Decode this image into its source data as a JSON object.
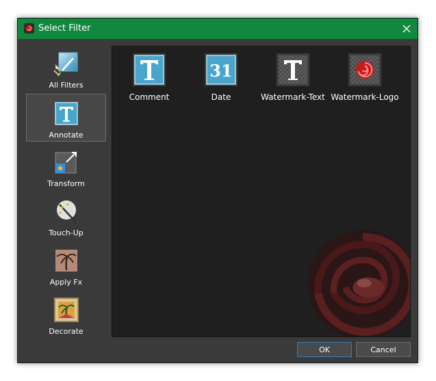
{
  "window": {
    "title": "Select Filter",
    "accent": "#10893e"
  },
  "categories": [
    {
      "label": "All Filters",
      "icon": "magic-wand-icon"
    },
    {
      "label": "Annotate",
      "icon": "text-t-icon"
    },
    {
      "label": "Transform",
      "icon": "resize-arrow-icon"
    },
    {
      "label": "Touch-Up",
      "icon": "wand-sparkle-icon"
    },
    {
      "label": "Apply Fx",
      "icon": "palm-tree-icon"
    },
    {
      "label": "Decorate",
      "icon": "framed-palm-icon"
    }
  ],
  "selected_category": "Annotate",
  "filters": [
    {
      "label": "Comment",
      "icon": "text-t-icon"
    },
    {
      "label": "Date",
      "icon": "calendar-31-icon"
    },
    {
      "label": "Watermark-Text",
      "icon": "watermark-t-icon"
    },
    {
      "label": "Watermark-Logo",
      "icon": "watermark-logo-icon"
    }
  ],
  "buttons": {
    "ok": "OK",
    "cancel": "Cancel"
  }
}
